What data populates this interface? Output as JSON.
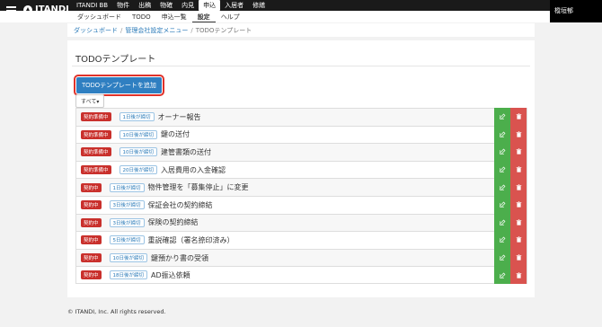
{
  "header": {
    "logo_text": "ITANDI",
    "nav": [
      "ITANDI BB",
      "物件",
      "出稿",
      "物確",
      "内見",
      "申込",
      "入居者",
      "修繕"
    ],
    "nav_active_index": 5,
    "user_name": "樅垣郁"
  },
  "subnav": {
    "items": [
      "ダッシュボード",
      "TODO",
      "申込一覧",
      "設定",
      "ヘルプ"
    ],
    "active_index": 3
  },
  "breadcrumb": {
    "items": [
      "ダッシュボード",
      "管理会社設定メニュー",
      "TODOテンプレート"
    ]
  },
  "page": {
    "title": "TODOテンプレート",
    "add_button_label": "TODOテンプレートを追加",
    "filter_label": "すべて▾"
  },
  "todos": [
    {
      "status": "契約準備中",
      "due": "1日後が締切",
      "name": "オーナー報告"
    },
    {
      "status": "契約準備中",
      "due": "10日後が締切",
      "name": "鍵の送付"
    },
    {
      "status": "契約準備中",
      "due": "10日後が締切",
      "name": "建管書類の送付"
    },
    {
      "status": "契約準備中",
      "due": "20日後が締切",
      "name": "入居費用の入金確認"
    },
    {
      "status": "契約中",
      "due": "1日後が締切",
      "name": "物件管理を「募集停止」に変更"
    },
    {
      "status": "契約中",
      "due": "3日後が締切",
      "name": "保証会社の契約締結"
    },
    {
      "status": "契約中",
      "due": "3日後が締切",
      "name": "保険の契約締結"
    },
    {
      "status": "契約中",
      "due": "5日後が締切",
      "name": "重説確認（署名捺印済み）"
    },
    {
      "status": "契約中",
      "due": "10日後が締切",
      "name": "鍵預かり書の受領"
    },
    {
      "status": "契約中",
      "due": "18日後が締切",
      "name": "AD振込依頼"
    }
  ],
  "footer": {
    "copyright": "© ITANDI, Inc. All rights reserved."
  },
  "colors": {
    "topbar": "#1a1a1a",
    "primary": "#2f7fc1",
    "status_red": "#c9302c",
    "edit_green": "#4cae4c",
    "delete_red": "#d9534f"
  }
}
